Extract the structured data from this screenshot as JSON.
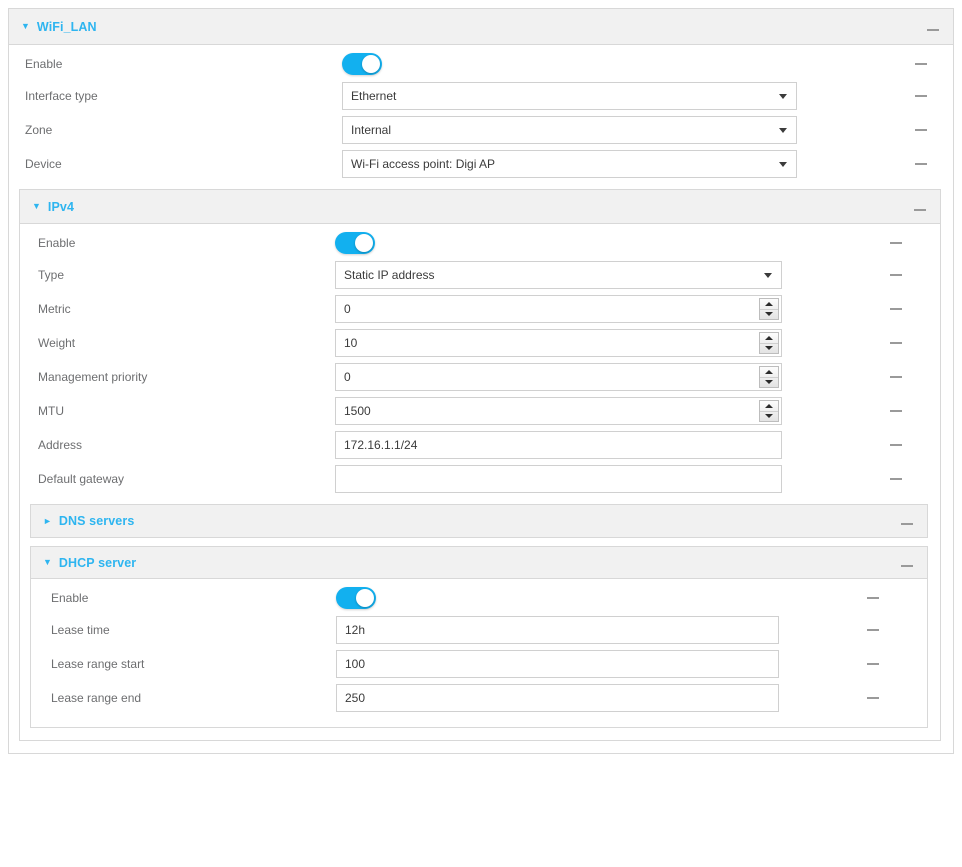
{
  "wifi_lan": {
    "title": "WiFi_LAN",
    "caret": "▼",
    "minus": "minus-icon",
    "rows": {
      "enable": {
        "label": "Enable",
        "value": "on"
      },
      "interface_type": {
        "label": "Interface type",
        "value": "Ethernet"
      },
      "zone": {
        "label": "Zone",
        "value": "Internal"
      },
      "device": {
        "label": "Device",
        "value": "Wi-Fi access point: Digi AP"
      }
    },
    "ipv4": {
      "title": "IPv4",
      "caret": "▼",
      "rows": {
        "enable": {
          "label": "Enable",
          "value": "on"
        },
        "type": {
          "label": "Type",
          "value": "Static IP address"
        },
        "metric": {
          "label": "Metric",
          "value": "0"
        },
        "weight": {
          "label": "Weight",
          "value": "10"
        },
        "management_priority": {
          "label": "Management priority",
          "value": "0"
        },
        "mtu": {
          "label": "MTU",
          "value": "1500"
        },
        "address": {
          "label": "Address",
          "value": "172.16.1.1/24"
        },
        "default_gateway": {
          "label": "Default gateway",
          "value": ""
        }
      },
      "dns_servers": {
        "title": "DNS servers",
        "caret": "►",
        "expanded": false
      },
      "dhcp_server": {
        "title": "DHCP server",
        "caret": "▼",
        "expanded": true,
        "rows": {
          "enable": {
            "label": "Enable",
            "value": "on"
          },
          "lease_time": {
            "label": "Lease time",
            "value": "12h"
          },
          "lease_range_start": {
            "label": "Lease range start",
            "value": "100"
          },
          "lease_range_end": {
            "label": "Lease range end",
            "value": "250"
          }
        }
      }
    }
  },
  "colors": {
    "accent": "#2eb5f0",
    "toggle_on": "#12b0ef",
    "label": "#6d6e70",
    "panel_head_bg": "#f1f1f1",
    "border": "#d8d8d8"
  }
}
